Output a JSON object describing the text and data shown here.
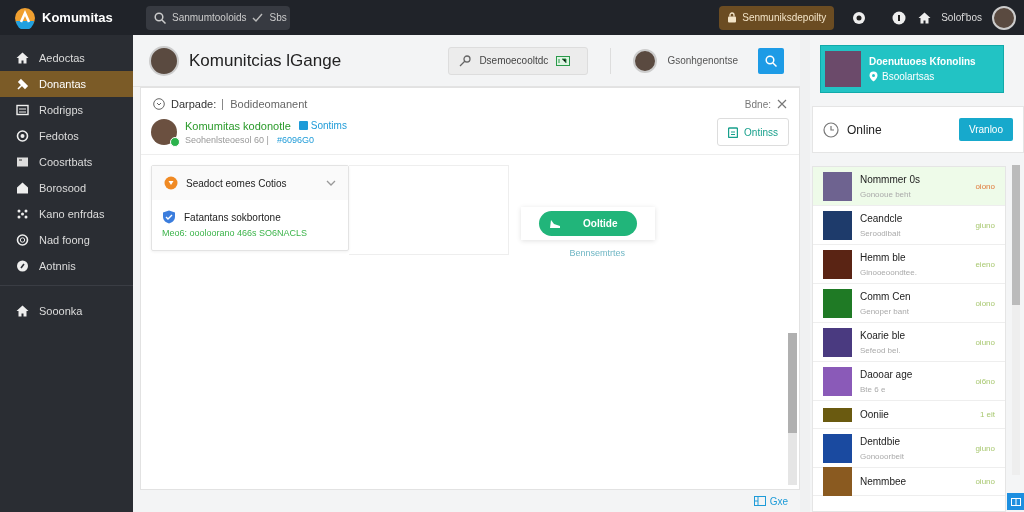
{
  "topbar": {
    "brand": "Komumitas",
    "search": {
      "value": "Sanmumtooloids",
      "suffix": "Sbs"
    },
    "badge": "Senmuniksdepoilty",
    "user_label": "Solof'bos"
  },
  "sidebar": {
    "items": [
      {
        "label": "Aedoctas",
        "selected": false
      },
      {
        "label": "Donantas",
        "selected": true
      },
      {
        "label": "Rodrigps",
        "selected": false
      },
      {
        "label": "Fedotos",
        "selected": false
      },
      {
        "label": "Coosrtbats",
        "selected": false
      },
      {
        "label": "Borosood",
        "selected": false
      },
      {
        "label": "Kano enfrdas",
        "selected": false
      },
      {
        "label": "Nad foong",
        "selected": false
      },
      {
        "label": "Aotnnis",
        "selected": false
      }
    ],
    "bottom_item": {
      "label": "Sooonka",
      "selected": false
    }
  },
  "header": {
    "title": "Komunitcias lGange",
    "search": {
      "value": "Dsemoecooltdc"
    },
    "profile_name": "Gsonhgenontse"
  },
  "card": {
    "crumb": "Darpade:",
    "crumb_detail": "Bodideomanent",
    "close_label": "Bdne:",
    "post": {
      "author": "Komumitas kodonotle",
      "tag": "Sontims",
      "meta": "Seohenlsteoesol 60 |",
      "code": "#6096G0",
      "online": true,
      "button": "Ontinss"
    },
    "dropdown": {
      "title": "Seadoct eomes Cotios",
      "expanded": false,
      "option": "Fatantans  sokbortone",
      "option_note": "Meo6: oooloorano 466s  SO6NACLS"
    },
    "action_button": "Ooltide",
    "action_note": "Bennsemtrtes"
  },
  "footer": {
    "link": "Gxe"
  },
  "right": {
    "feature": {
      "title": "Doenutuoes Kfonolins",
      "subtitle": "Bsoolartsas"
    },
    "status": {
      "label": "Online",
      "button": "Vranloo"
    },
    "list": [
      {
        "name": "Nommmer 0s",
        "sub": "Gonooue beht",
        "value": "oiono",
        "selected": true
      },
      {
        "name": "Ceandcle",
        "sub": "Seroodlbait",
        "value": "giuno",
        "selected": false
      },
      {
        "name": "Hemm ble",
        "sub": "Ginooeoondtee.",
        "value": "eieno",
        "selected": false
      },
      {
        "name": "Comm Cen",
        "sub": "Genoper bant",
        "value": "oiono",
        "selected": false
      },
      {
        "name": "Koarie ble",
        "sub": "Sefeod bel.",
        "value": "oiuno",
        "selected": false
      },
      {
        "name": "Daooar age",
        "sub": "Bte 6 e",
        "value": "oi6no",
        "selected": false
      },
      {
        "name": "Ooniie",
        "value": "1 eit",
        "selected": false
      },
      {
        "name": "Dentdbie",
        "sub": "Gonooorbeit",
        "value": "giuno",
        "selected": false
      },
      {
        "name": "Nemmbee",
        "value": "oiuno",
        "selected": false
      }
    ]
  }
}
